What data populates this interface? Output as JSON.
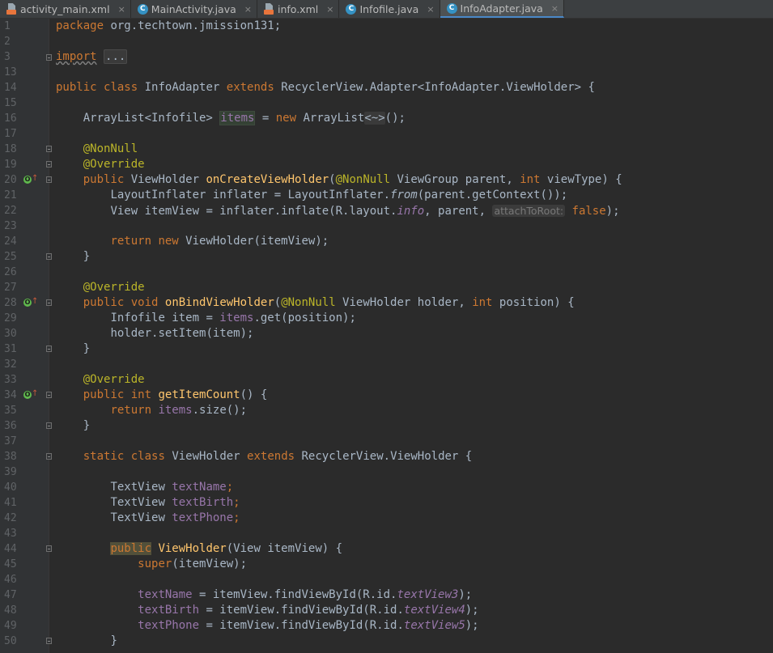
{
  "tabs": [
    {
      "label": "activity_main.xml",
      "icon": "xml-file-icon",
      "close": "×"
    },
    {
      "label": "MainActivity.java",
      "icon": "java-class-icon",
      "close": "×"
    },
    {
      "label": "info.xml",
      "icon": "xml-file-icon",
      "close": "×"
    },
    {
      "label": "Infofile.java",
      "icon": "java-class-icon",
      "close": "×"
    },
    {
      "label": "InfoAdapter.java",
      "icon": "java-class-icon",
      "close": "×",
      "active": true
    }
  ],
  "class_icon_letter": "C",
  "gutter": {
    "line_numbers": [
      "1",
      "2",
      "3",
      "13",
      "14",
      "15",
      "16",
      "17",
      "18",
      "19",
      "20",
      "21",
      "22",
      "23",
      "24",
      "25",
      "26",
      "27",
      "28",
      "29",
      "30",
      "31",
      "32",
      "33",
      "34",
      "35",
      "36",
      "37",
      "38",
      "39",
      "40",
      "41",
      "42",
      "43",
      "44",
      "45",
      "46",
      "47",
      "48",
      "49",
      "50"
    ],
    "override_marker": "O",
    "override_arrow": "↑",
    "override_lines": [
      "20",
      "28",
      "34"
    ]
  },
  "code": {
    "l1": {
      "kw": "package",
      "rest": " org.techtown.jmission131;"
    },
    "l3": {
      "kw": "import",
      "fold": "..."
    },
    "l14": {
      "kw1": "public",
      "kw2": "class",
      "name": "InfoAdapter",
      "kw3": "extends",
      "rest": " RecyclerView.Adapter<InfoAdapter.ViewHolder> {"
    },
    "l16": {
      "type": "ArrayList<Infofile> ",
      "field": "items",
      "eq": " = ",
      "kw": "new",
      "ctor": " ArrayList",
      "diamond": "<~>",
      "end": "();"
    },
    "l18": {
      "ann": "@NonNull"
    },
    "l19": {
      "ann": "@Override"
    },
    "l20": {
      "kw": "public",
      "type": " ViewHolder ",
      "method": "onCreateViewHolder",
      "p1": "(",
      "ann": "@NonNull",
      "p2": " ViewGroup parent, ",
      "kw2": "int",
      "p3": " viewType) {"
    },
    "l21": {
      "a": "LayoutInflater inflater = LayoutInflater.",
      "italic": "from",
      "b": "(parent.getContext());"
    },
    "l22": {
      "a": "View itemView = inflater.inflate(R.layout.",
      "static": "info",
      "b": ", parent, ",
      "hint": "attachToRoot:",
      "kw": "false",
      "c": ");"
    },
    "l24": {
      "kw1": "return",
      "kw2": "new",
      "rest": " ViewHolder(itemView);"
    },
    "l25": {
      "text": "}"
    },
    "l27": {
      "ann": "@Override"
    },
    "l28": {
      "kw1": "public",
      "kw2": "void",
      "method": "onBindViewHolder",
      "p1": "(",
      "ann": "@NonNull",
      "p2": " ViewHolder holder, ",
      "kw3": "int",
      "p3": " position) {"
    },
    "l29": {
      "a": "Infofile item = ",
      "field": "items",
      "b": ".get(position);"
    },
    "l30": {
      "text": "holder.setItem(item);"
    },
    "l31": {
      "text": "}"
    },
    "l33": {
      "ann": "@Override"
    },
    "l34": {
      "kw1": "public",
      "kw2": "int",
      "method": "getItemCount",
      "rest": "() {"
    },
    "l35": {
      "kw": "return",
      "field": "items",
      "rest": ".size();"
    },
    "l36": {
      "text": "}"
    },
    "l38": {
      "kw1": "static",
      "kw2": "class",
      "name": " ViewHolder ",
      "kw3": "extends",
      "rest": " RecyclerView.ViewHolder {"
    },
    "l40": {
      "type": "TextView ",
      "field": "textName",
      "end": ";"
    },
    "l41": {
      "type": "TextView ",
      "field": "textBirth",
      "end": ";"
    },
    "l42": {
      "type": "TextView ",
      "field": "textPhone",
      "end": ";"
    },
    "l44": {
      "kw": "public",
      "method": "ViewHolder",
      "rest": "(View itemView) {"
    },
    "l45": {
      "kw": "super",
      "rest": "(itemView);"
    },
    "l47": {
      "field": "textName",
      "a": " = itemView.findViewById(R.id.",
      "static": "textView3",
      "b": ");"
    },
    "l48": {
      "field": "textBirth",
      "a": " = itemView.findViewById(R.id.",
      "static": "textView4",
      "b": ");"
    },
    "l49": {
      "field": "textPhone",
      "a": " = itemView.findViewById(R.id.",
      "static": "textView5",
      "b": ");"
    },
    "l50": {
      "text": "}"
    }
  }
}
